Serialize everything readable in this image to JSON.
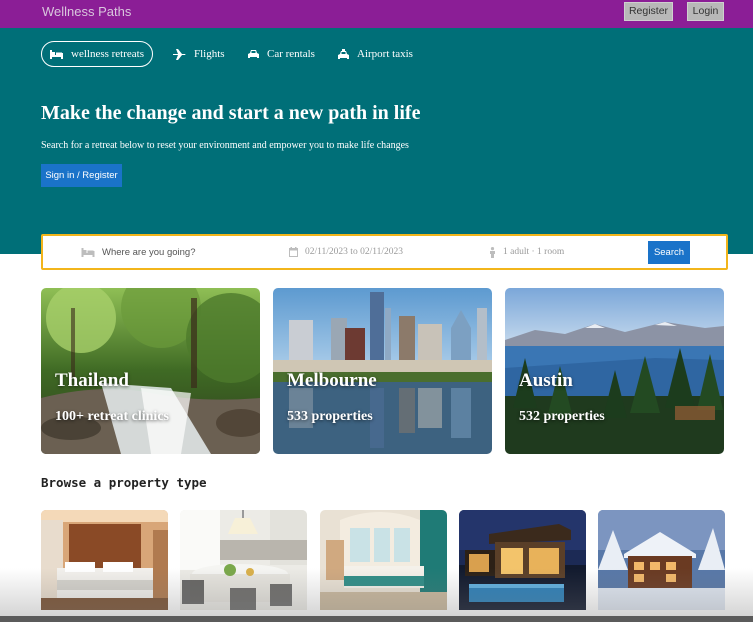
{
  "header": {
    "brand": "Wellness Paths",
    "register_label": "Register",
    "login_label": "Login"
  },
  "nav": {
    "tabs": [
      {
        "label": "wellness retreats",
        "icon": "bed-icon",
        "active": true
      },
      {
        "label": "Flights",
        "icon": "plane-icon",
        "active": false
      },
      {
        "label": "Car rentals",
        "icon": "car-icon",
        "active": false
      },
      {
        "label": "Airport taxis",
        "icon": "taxi-icon",
        "active": false
      }
    ]
  },
  "hero": {
    "title": "Make the change and start a new path in life",
    "subtitle": "Search for a retreat below to reset your environment and empower you to make life changes",
    "cta_label": "Sign in / Register"
  },
  "search": {
    "destination_placeholder": "Where are you going?",
    "dates": "02/11/2023 to 02/11/2023",
    "guests": "1 adult · 1 room",
    "button_label": "Search"
  },
  "destinations": [
    {
      "title": "Thailand",
      "subtitle": "100+ retreat clinics"
    },
    {
      "title": "Melbourne",
      "subtitle": "533 properties"
    },
    {
      "title": "Austin",
      "subtitle": "532 properties"
    }
  ],
  "property_types": {
    "heading": "Browse a property type",
    "items": [
      {
        "image": "hotel-bedroom"
      },
      {
        "image": "apartment-kitchen"
      },
      {
        "image": "resort-room"
      },
      {
        "image": "modern-villa"
      },
      {
        "image": "snowy-cabin"
      }
    ]
  },
  "colors": {
    "topbar": "#8b1e96",
    "hero": "#006f78",
    "accent_blue": "#1a73c9",
    "search_border": "#f2b51b"
  }
}
